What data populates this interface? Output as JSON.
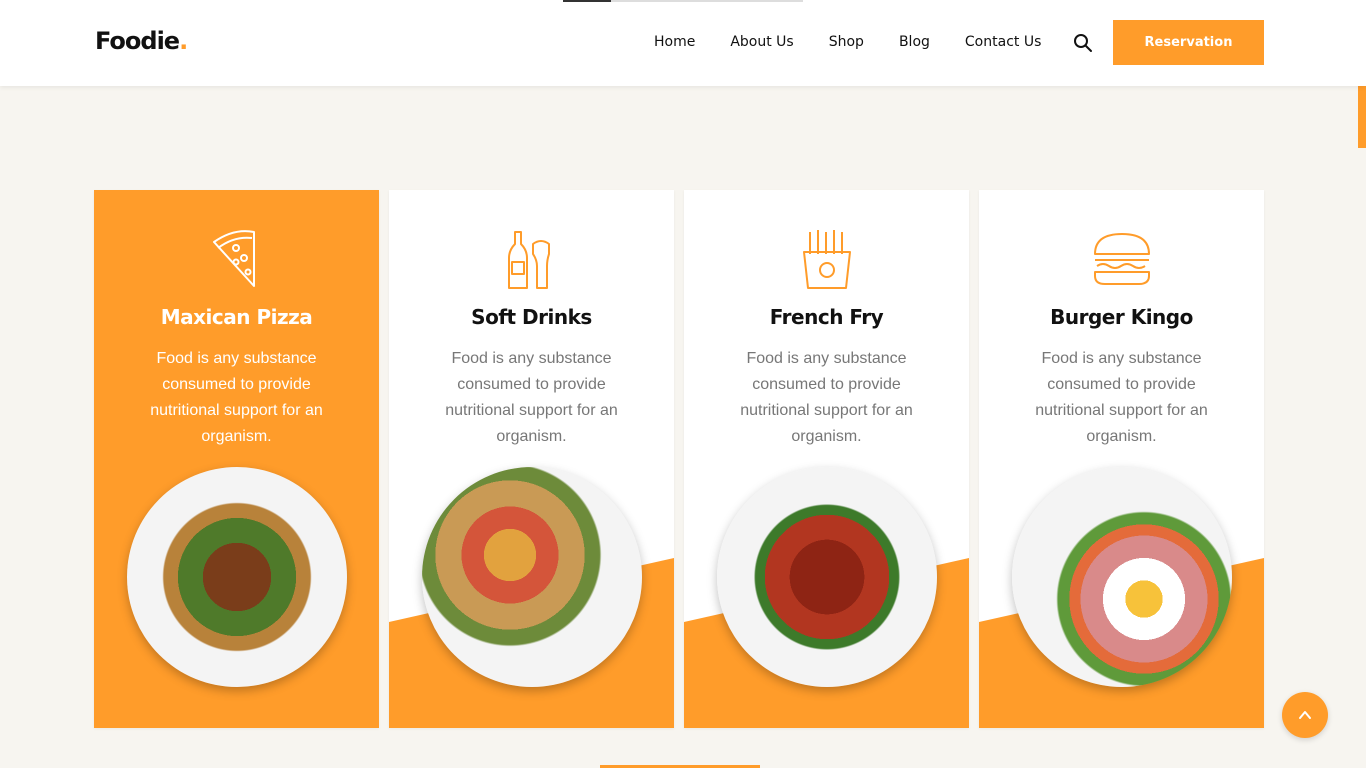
{
  "brand": {
    "name": "Foodie",
    "dot": ".",
    "accent": "#ff9c2a"
  },
  "nav": {
    "items": [
      "Home",
      "About Us",
      "Shop",
      "Blog",
      "Contact Us"
    ],
    "search_icon": "search-icon",
    "reservation_label": "Reservation"
  },
  "cards": [
    {
      "title": "Maxican Pizza",
      "desc": "Food is any substance consumed to provide nutritional support for an organism.",
      "icon": "pizza-icon",
      "active": true
    },
    {
      "title": "Soft Drinks",
      "desc": "Food is any substance consumed to provide nutritional support for an organism.",
      "icon": "drinks-icon",
      "active": false
    },
    {
      "title": "French Fry",
      "desc": "Food is any substance consumed to provide nutritional support for an organism.",
      "icon": "french-fry-icon",
      "active": false
    },
    {
      "title": "Burger Kingo",
      "desc": "Food is any substance consumed to provide nutritional support for an organism.",
      "icon": "burger-icon",
      "active": false
    }
  ],
  "scroll_top_icon": "chevron-up-icon"
}
